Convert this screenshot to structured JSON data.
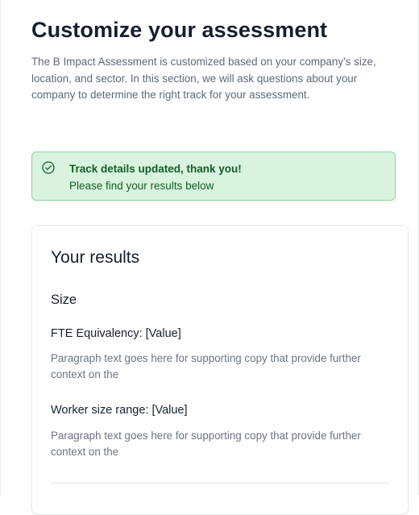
{
  "header": {
    "title": "Customize your assessment",
    "intro": "The B Impact Assessment is customized based on your company’s size, location, and sector. In this section, we will ask questions about your company to determine the right track for your assessment."
  },
  "alert": {
    "icon": "check-circle-icon",
    "title": "Track details updated, thank you!",
    "body": "Please find your results below",
    "colors": {
      "background": "#d9f3de",
      "border": "#8fd39c",
      "text": "#145c2a"
    }
  },
  "results": {
    "title": "Your results",
    "section_title": "Size",
    "fields": [
      {
        "label": "FTE Equivalency: [Value]",
        "description": "Paragraph text goes here for supporting copy that provide further context on the"
      },
      {
        "label": "Worker size range: [Value]",
        "description": "Paragraph text goes here for supporting copy that provide further context on the"
      }
    ]
  }
}
